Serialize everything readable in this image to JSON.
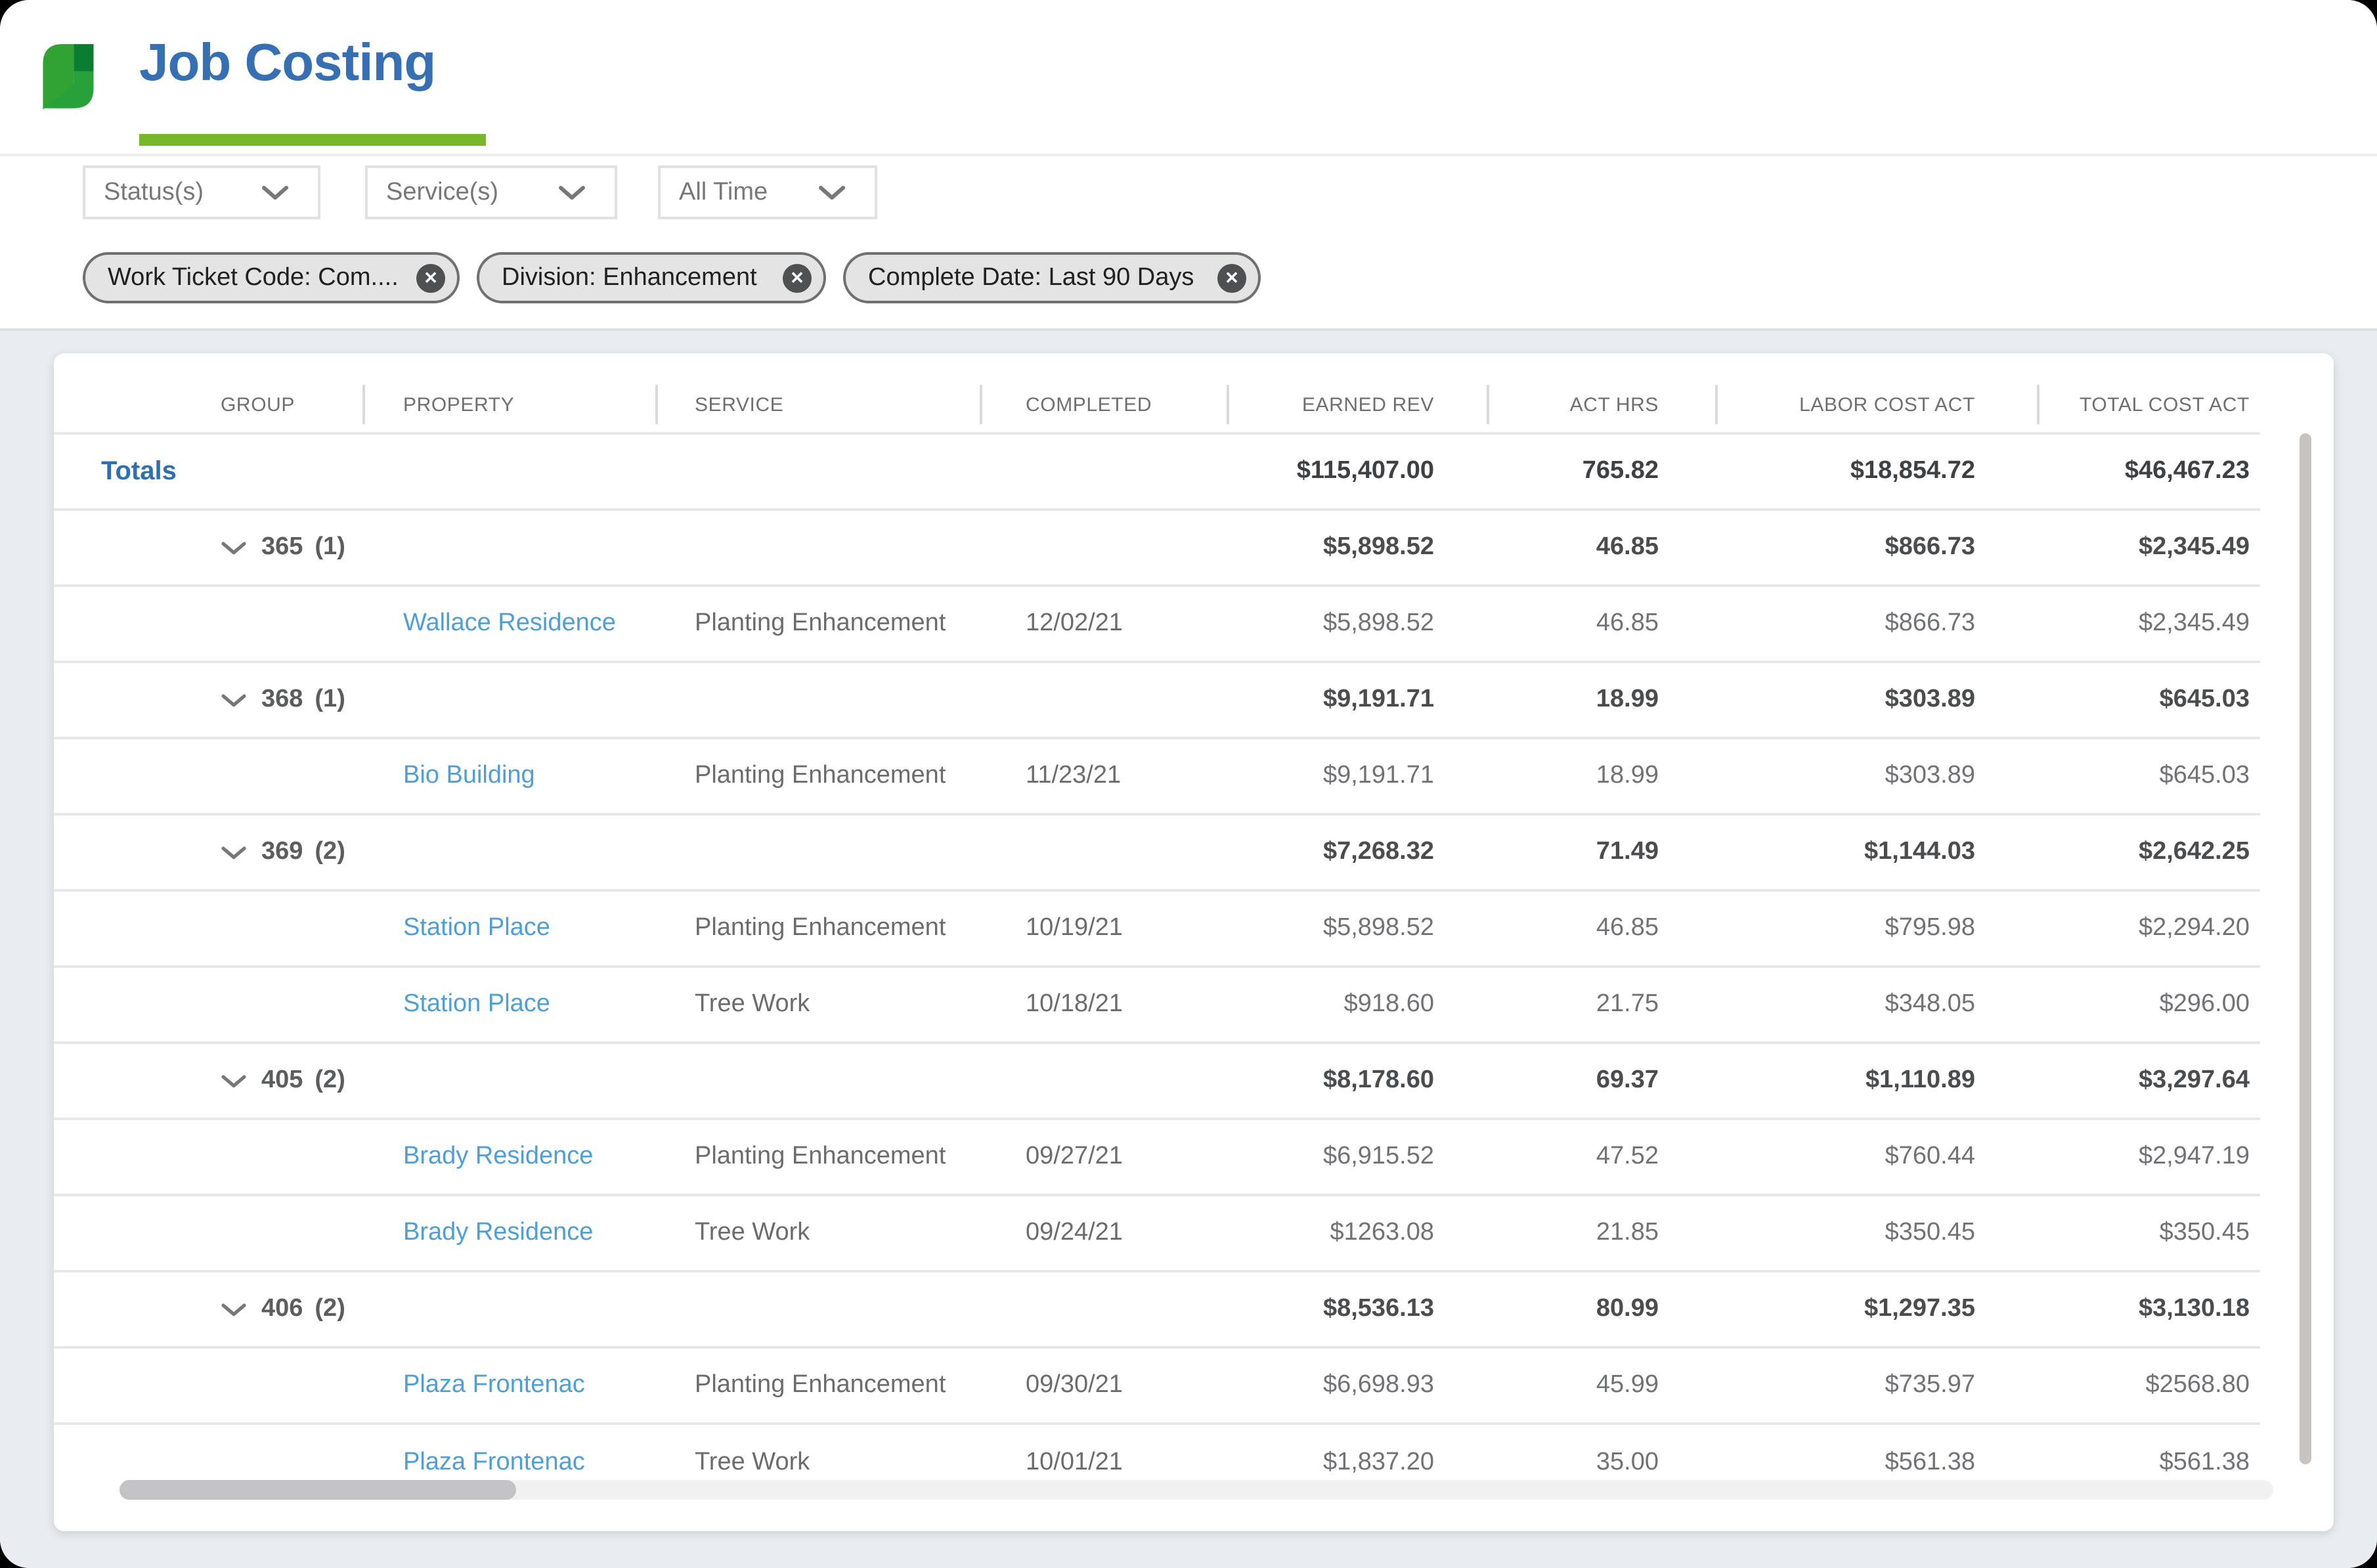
{
  "header": {
    "app_title": "Job Costing"
  },
  "colors": {
    "title_blue": "#366fb2",
    "accent_green": "#76b82a",
    "logo_green_bright": "#31a335",
    "logo_green_dark": "#0b7d33",
    "logo_green_mid": "#28a13b",
    "link_blue": "#4f9fd4"
  },
  "filters": {
    "dropdowns": [
      {
        "label": "Status(s)"
      },
      {
        "label": "Service(s)"
      },
      {
        "label": "All Time"
      }
    ],
    "chips": [
      {
        "label": "Work Ticket Code: Com...."
      },
      {
        "label": "Division: Enhancement"
      },
      {
        "label": "Complete Date: Last 90 Days"
      }
    ]
  },
  "table": {
    "columns": [
      "GROUP",
      "PROPERTY",
      "SERVICE",
      "COMPLETED",
      "EARNED REV",
      "ACT HRS",
      "LABOR COST ACT",
      "TOTAL COST ACT"
    ],
    "totals": {
      "label": "Totals",
      "earned_rev": "$115,407.00",
      "act_hrs": "765.82",
      "labor_cost_act": "$18,854.72",
      "total_cost_act": "$46,467.23"
    },
    "rows": [
      {
        "type": "group",
        "group": "365",
        "count": "(1)",
        "earned_rev": "$5,898.52",
        "act_hrs": "46.85",
        "labor_cost_act": "$866.73",
        "total_cost_act": "$2,345.49"
      },
      {
        "type": "detail",
        "property": "Wallace Residence",
        "service": "Planting Enhancement",
        "completed": "12/02/21",
        "earned_rev": "$5,898.52",
        "act_hrs": "46.85",
        "labor_cost_act": "$866.73",
        "total_cost_act": "$2,345.49"
      },
      {
        "type": "group",
        "group": "368",
        "count": "(1)",
        "earned_rev": "$9,191.71",
        "act_hrs": "18.99",
        "labor_cost_act": "$303.89",
        "total_cost_act": "$645.03"
      },
      {
        "type": "detail",
        "property": "Bio Building",
        "service": "Planting Enhancement",
        "completed": "11/23/21",
        "earned_rev": "$9,191.71",
        "act_hrs": "18.99",
        "labor_cost_act": "$303.89",
        "total_cost_act": "$645.03"
      },
      {
        "type": "group",
        "group": "369",
        "count": "(2)",
        "earned_rev": "$7,268.32",
        "act_hrs": "71.49",
        "labor_cost_act": "$1,144.03",
        "total_cost_act": "$2,642.25"
      },
      {
        "type": "detail",
        "property": "Station Place",
        "service": "Planting Enhancement",
        "completed": "10/19/21",
        "earned_rev": "$5,898.52",
        "act_hrs": "46.85",
        "labor_cost_act": "$795.98",
        "total_cost_act": "$2,294.20"
      },
      {
        "type": "detail",
        "property": "Station Place",
        "service": "Tree Work",
        "completed": "10/18/21",
        "earned_rev": "$918.60",
        "act_hrs": "21.75",
        "labor_cost_act": "$348.05",
        "total_cost_act": "$296.00"
      },
      {
        "type": "group",
        "group": "405",
        "count": "(2)",
        "earned_rev": "$8,178.60",
        "act_hrs": "69.37",
        "labor_cost_act": "$1,110.89",
        "total_cost_act": "$3,297.64"
      },
      {
        "type": "detail",
        "property": "Brady Residence",
        "service": "Planting Enhancement",
        "completed": "09/27/21",
        "earned_rev": "$6,915.52",
        "act_hrs": "47.52",
        "labor_cost_act": "$760.44",
        "total_cost_act": "$2,947.19"
      },
      {
        "type": "detail",
        "property": "Brady Residence",
        "service": "Tree Work",
        "completed": "09/24/21",
        "earned_rev": "$1263.08",
        "act_hrs": "21.85",
        "labor_cost_act": "$350.45",
        "total_cost_act": "$350.45"
      },
      {
        "type": "group",
        "group": "406",
        "count": "(2)",
        "earned_rev": "$8,536.13",
        "act_hrs": "80.99",
        "labor_cost_act": "$1,297.35",
        "total_cost_act": "$3,130.18"
      },
      {
        "type": "detail",
        "property": "Plaza Frontenac",
        "service": "Planting Enhancement",
        "completed": "09/30/21",
        "earned_rev": "$6,698.93",
        "act_hrs": "45.99",
        "labor_cost_act": "$735.97",
        "total_cost_act": "$2568.80"
      },
      {
        "type": "detail",
        "property": "Plaza Frontenac",
        "service": "Tree Work",
        "completed": "10/01/21",
        "earned_rev": "$1,837.20",
        "act_hrs": "35.00",
        "labor_cost_act": "$561.38",
        "total_cost_act": "$561.38"
      }
    ]
  }
}
